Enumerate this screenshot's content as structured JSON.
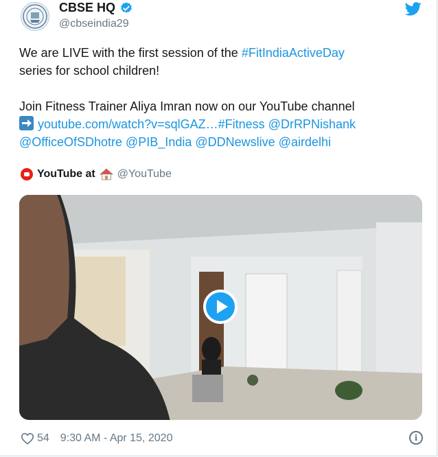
{
  "tweet": {
    "author": {
      "display_name": "CBSE HQ",
      "handle": "@cbseindia29",
      "verified": true
    },
    "body_lines": [
      [
        {
          "text": "We are LIVE with the first session of the ",
          "style": "plain"
        },
        {
          "text": "#FitIndiaActiveDay",
          "style": "link"
        }
      ],
      [
        {
          "text": " series for school children!",
          "style": "plain"
        }
      ],
      [],
      [
        {
          "text": "Join Fitness Trainer Aliya Imran now on our YouTube channel",
          "style": "plain"
        }
      ],
      [
        {
          "text": "",
          "style": "arrow-emoji"
        },
        {
          "text": "youtube.com/watch?v=sqlGAZ…",
          "style": "link"
        },
        {
          "text": "#Fitness",
          "style": "link"
        },
        {
          "text": " ",
          "style": "plain"
        },
        {
          "text": "@DrRPNishank",
          "style": "link"
        }
      ],
      [
        {
          "text": "@OfficeOfSDhotre",
          "style": "link"
        },
        {
          "text": " ",
          "style": "plain"
        },
        {
          "text": "@PIB_India",
          "style": "link"
        },
        {
          "text": " ",
          "style": "plain"
        },
        {
          "text": "@DDNewslive",
          "style": "link"
        },
        {
          "text": " ",
          "style": "plain"
        },
        {
          "text": "@airdelhi",
          "style": "link"
        }
      ]
    ],
    "source": {
      "name": "YouTube at",
      "handle": "@YouTube",
      "logo_icon": "youtube-logo-icon",
      "emoji_icon": "house-emoji-icon"
    },
    "media": {
      "type": "video",
      "play_icon": "play-icon"
    },
    "footer": {
      "like_count": "54",
      "timestamp": "9:30 AM - Apr 15, 2020",
      "like_icon": "heart-icon",
      "info_icon": "info-icon",
      "info_glyph": "i"
    }
  },
  "colors": {
    "link": "#1b95e0",
    "text": "#14171a",
    "muted": "#657786",
    "twitter_blue": "#1da1f2",
    "youtube_red": "#e62117"
  }
}
